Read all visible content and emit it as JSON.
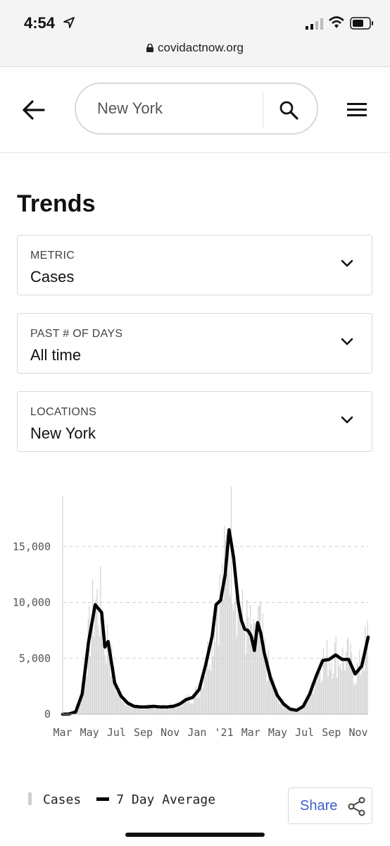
{
  "status_bar": {
    "time": "4:54",
    "url": "covidactnow.org"
  },
  "search": {
    "value": "New York"
  },
  "page": {
    "title": "Trends"
  },
  "dropdowns": [
    {
      "label": "METRIC",
      "value": "Cases"
    },
    {
      "label": "PAST # OF DAYS",
      "value": "All time"
    },
    {
      "label": "LOCATIONS",
      "value": "New York"
    }
  ],
  "chart_data": {
    "type": "bar",
    "y_ticks": [
      "0",
      "5,000",
      "10,000",
      "15,000"
    ],
    "ylim": [
      0,
      19500
    ],
    "x_ticks": [
      "Mar",
      "May",
      "Jul",
      "Sep",
      "Nov",
      "Jan",
      "'21",
      "Mar",
      "May",
      "Jul",
      "Sep",
      "Nov"
    ],
    "grid": "horizontal-dashed",
    "series": [
      {
        "name": "Cases",
        "kind": "daily-bars",
        "color": "#cfcfcf"
      },
      {
        "name": "7 Day Average",
        "kind": "line",
        "color": "#000000",
        "points": [
          [
            0,
            0
          ],
          [
            1,
            20
          ],
          [
            2,
            200
          ],
          [
            3,
            1800
          ],
          [
            4,
            6500
          ],
          [
            5,
            9800
          ],
          [
            6,
            9100
          ],
          [
            6.5,
            6000
          ],
          [
            7,
            6500
          ],
          [
            8,
            2800
          ],
          [
            9,
            1600
          ],
          [
            10,
            1000
          ],
          [
            11,
            700
          ],
          [
            12,
            650
          ],
          [
            13,
            650
          ],
          [
            14,
            700
          ],
          [
            15,
            650
          ],
          [
            16,
            650
          ],
          [
            17,
            700
          ],
          [
            18,
            900
          ],
          [
            19,
            1300
          ],
          [
            20,
            1500
          ],
          [
            21,
            2200
          ],
          [
            22,
            4400
          ],
          [
            23,
            7000
          ],
          [
            23.6,
            9800
          ],
          [
            24.3,
            10200
          ],
          [
            25,
            12500
          ],
          [
            25.6,
            16500
          ],
          [
            26.3,
            14000
          ],
          [
            27,
            10000
          ],
          [
            27.5,
            8400
          ],
          [
            28,
            7600
          ],
          [
            28.5,
            7500
          ],
          [
            29,
            7000
          ],
          [
            29.5,
            5700
          ],
          [
            30,
            8200
          ],
          [
            30.5,
            7200
          ],
          [
            31,
            5500
          ],
          [
            32,
            3200
          ],
          [
            33,
            1700
          ],
          [
            34,
            900
          ],
          [
            35,
            450
          ],
          [
            36,
            350
          ],
          [
            37,
            700
          ],
          [
            38,
            1800
          ],
          [
            39,
            3400
          ],
          [
            40,
            4800
          ],
          [
            41,
            4900
          ],
          [
            42,
            5300
          ],
          [
            43,
            4900
          ],
          [
            44,
            4900
          ],
          [
            45,
            3600
          ],
          [
            46,
            4300
          ],
          [
            47,
            6900
          ]
        ]
      }
    ]
  },
  "legend": {
    "cases": "Cases",
    "avg": "7 Day Average"
  },
  "share": {
    "label": "Share"
  },
  "icons": {
    "location": "location-arrow-icon",
    "signal": "cellular-signal-icon",
    "wifi": "wifi-icon",
    "battery": "battery-icon",
    "lock": "lock-icon",
    "back": "arrow-left-icon",
    "search": "search-icon",
    "menu": "hamburger-menu-icon",
    "chevron": "chevron-down-icon",
    "share": "share-icon"
  }
}
